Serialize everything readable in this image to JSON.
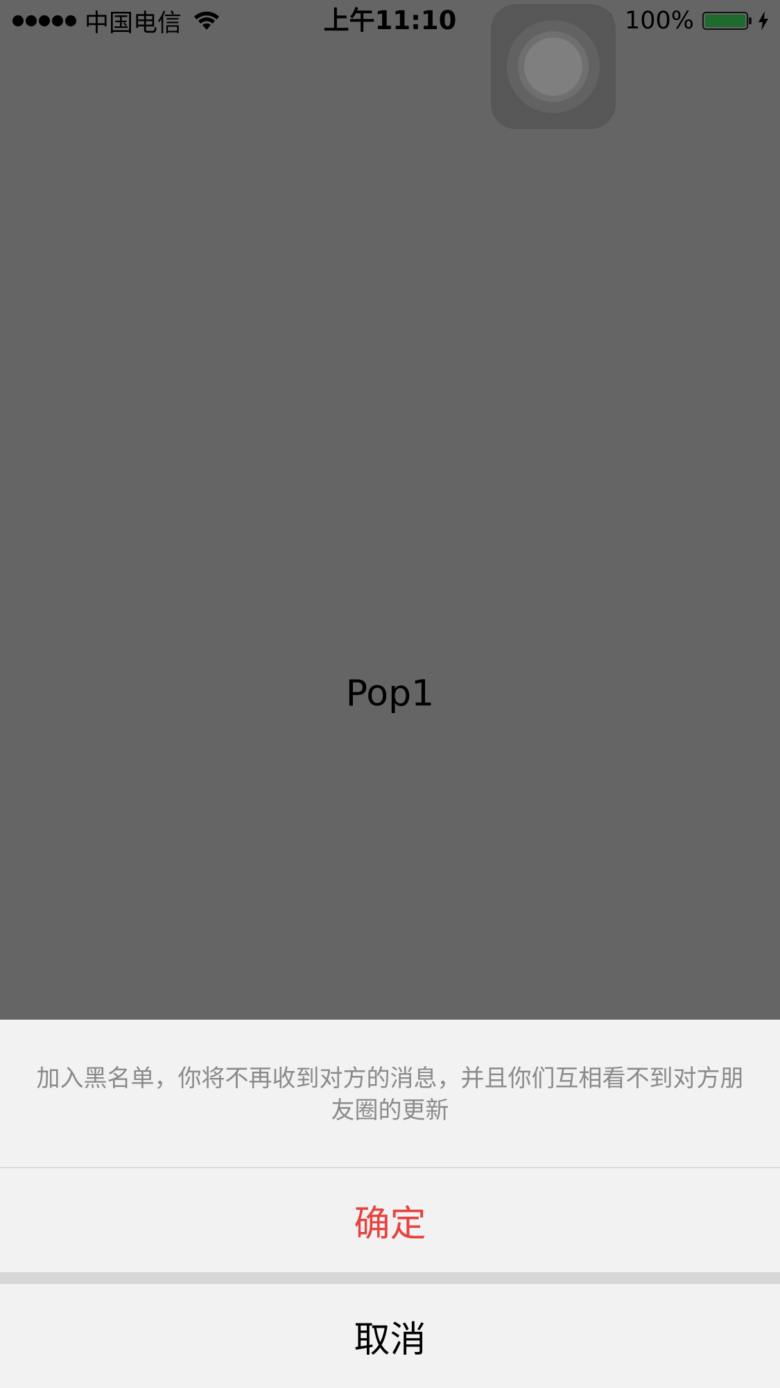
{
  "status_bar": {
    "carrier": "中国电信",
    "time": "上午11:10",
    "battery_percent": "100%",
    "battery_level": 1.0,
    "battery_color": "#1f6b2e",
    "icons": [
      "signal-icon",
      "wifi-icon",
      "rotation-lock-icon",
      "alarm-icon",
      "battery-icon",
      "charging-icon"
    ]
  },
  "main": {
    "label": "Pop1"
  },
  "action_sheet": {
    "message": "加入黑名单，你将不再收到对方的消息，并且你们互相看不到对方朋友圈的更新",
    "confirm_label": "确定",
    "confirm_color": "#e64340",
    "cancel_label": "取消"
  }
}
